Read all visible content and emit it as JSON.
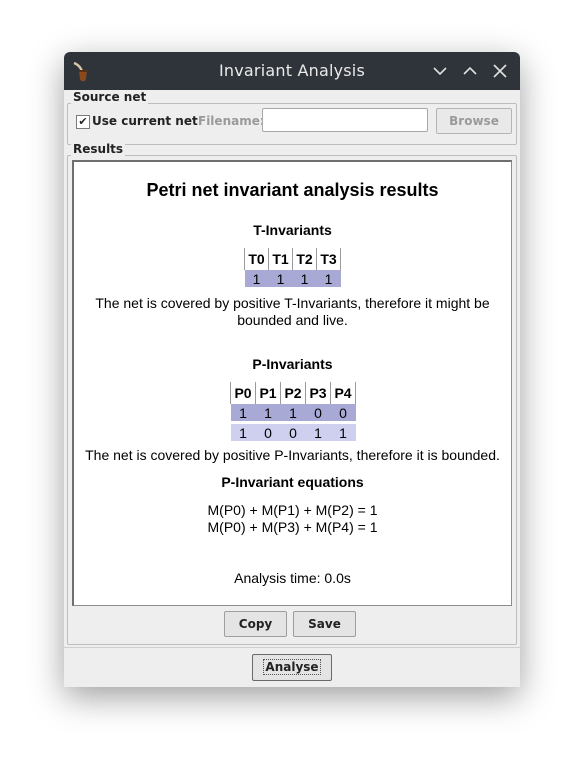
{
  "window": {
    "title": "Invariant Analysis",
    "controls": [
      "minimize-icon",
      "maximize-icon",
      "close-icon"
    ]
  },
  "source": {
    "legend": "Source net",
    "use_current_label": "Use current net",
    "use_current_checked": true,
    "filename_label": "Filename:",
    "filename_value": "",
    "browse_label": "Browse"
  },
  "results": {
    "legend": "Results",
    "title": "Petri net invariant analysis results",
    "t_heading": "T-Invariants",
    "t_headers": [
      "T0",
      "T1",
      "T2",
      "T3"
    ],
    "t_rows": [
      [
        "1",
        "1",
        "1",
        "1"
      ]
    ],
    "t_note": "The net is covered by positive T-Invariants, therefore it might be bounded and live.",
    "p_heading": "P-Invariants",
    "p_headers": [
      "P0",
      "P1",
      "P2",
      "P3",
      "P4"
    ],
    "p_rows": [
      [
        "1",
        "1",
        "1",
        "0",
        "0"
      ],
      [
        "1",
        "0",
        "0",
        "1",
        "1"
      ]
    ],
    "p_note": "The net is covered by positive P-Invariants, therefore it is bounded.",
    "eq_heading": "P-Invariant equations",
    "equations": [
      "M(P0) + M(P1) + M(P2) = 1",
      "M(P0) + M(P3) + M(P4) = 1"
    ],
    "time": "Analysis time: 0.0s"
  },
  "buttons": {
    "copy": "Copy",
    "save": "Save",
    "analyse": "Analyse"
  }
}
